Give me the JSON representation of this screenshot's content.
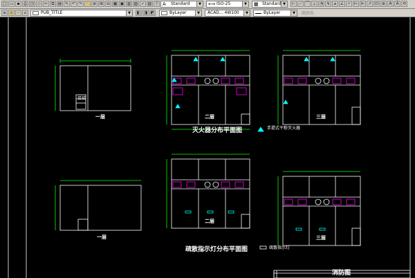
{
  "toolbar1": {
    "text_style": "Standard",
    "dim_style": "ISO-25",
    "table_style": "Standard"
  },
  "toolbar2": {
    "layer": "PUB_TITLE",
    "color": "ByLayer",
    "linetype": "ACAD... 4W100",
    "lineweight": "ByLayer",
    "plotstyle": "随颜色"
  },
  "drawing": {
    "floor1_label_top": "一层",
    "floor2_label_top": "二层",
    "floor3_label_top": "三层",
    "title_top": "灭火器分布平面图",
    "legend_top": "手提式干粉灭火器",
    "floor1_label_bottom": "一层",
    "floor2_label_bottom": "二层",
    "floor3_label_bottom": "三层",
    "title_bottom": "疏散指示灯分布平面图",
    "legend_bottom": "疏散指示灯",
    "titleblock_name": "消防图",
    "stair_label": "楼梯"
  },
  "colors": {
    "toolbar_bg": "#d4d0c8",
    "canvas_bg": "#000000",
    "outline": "#ffffff",
    "dimension": "#00ff00",
    "furniture": "#ff00ff",
    "symbol": "#00ffff"
  }
}
